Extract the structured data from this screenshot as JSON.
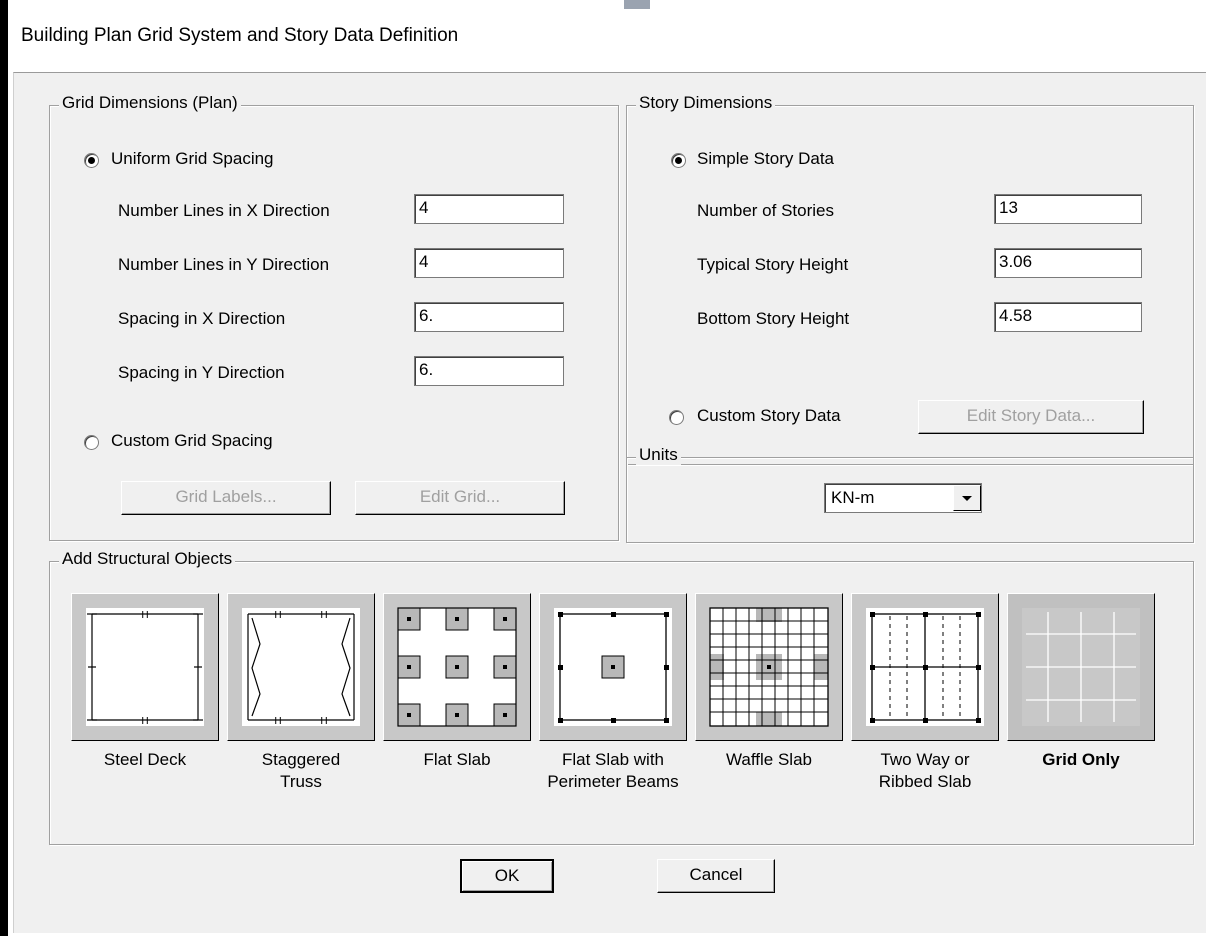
{
  "window": {
    "title": "Building Plan Grid System and Story Data Definition"
  },
  "grid_dimensions": {
    "title": "Grid Dimensions (Plan)",
    "uniform_label": "Uniform Grid Spacing",
    "uniform_selected": true,
    "fields": [
      {
        "label": "Number Lines in X Direction",
        "value": "4"
      },
      {
        "label": "Number Lines in Y Direction",
        "value": "4"
      },
      {
        "label": "Spacing in X Direction",
        "value": "6."
      },
      {
        "label": "Spacing in Y Direction",
        "value": "6."
      }
    ],
    "custom_label": "Custom Grid Spacing",
    "custom_selected": false,
    "grid_labels_button": "Grid Labels...",
    "edit_grid_button": "Edit Grid..."
  },
  "story_dimensions": {
    "title": "Story Dimensions",
    "simple_label": "Simple Story Data",
    "simple_selected": true,
    "fields": [
      {
        "label": "Number of Stories",
        "value": "13"
      },
      {
        "label": "Typical Story Height",
        "value": "3.06"
      },
      {
        "label": "Bottom Story Height",
        "value": "4.58"
      }
    ],
    "custom_label": "Custom Story Data",
    "custom_selected": false,
    "edit_story_button": "Edit Story Data..."
  },
  "units": {
    "title": "Units",
    "selected": "KN-m"
  },
  "structural_objects": {
    "title": "Add Structural Objects",
    "items": [
      {
        "icon": "steel-deck-icon",
        "line1": "Steel Deck",
        "line2": ""
      },
      {
        "icon": "staggered-truss-icon",
        "line1": "Staggered",
        "line2": "Truss"
      },
      {
        "icon": "flat-slab-icon",
        "line1": "Flat Slab",
        "line2": ""
      },
      {
        "icon": "flat-slab-perimeter-icon",
        "line1": "Flat Slab with",
        "line2": "Perimeter Beams"
      },
      {
        "icon": "waffle-slab-icon",
        "line1": "Waffle Slab",
        "line2": ""
      },
      {
        "icon": "two-way-ribbed-slab-icon",
        "line1": "Two Way or",
        "line2": "Ribbed Slab"
      },
      {
        "icon": "grid-only-icon",
        "line1": "Grid Only",
        "line2": "",
        "selected": true
      }
    ]
  },
  "buttons": {
    "ok": "OK",
    "cancel": "Cancel"
  }
}
